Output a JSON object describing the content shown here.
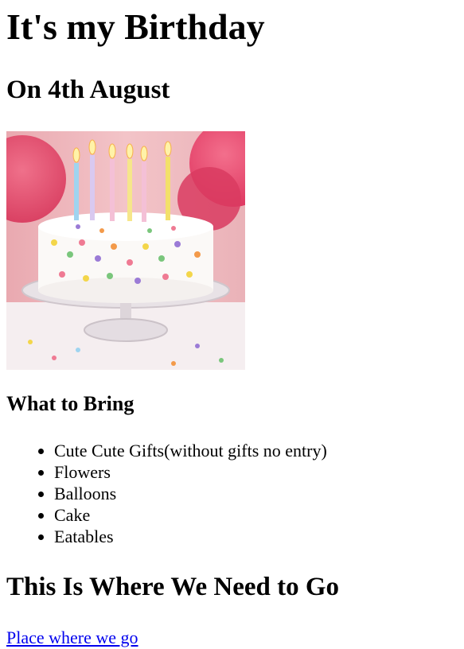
{
  "page": {
    "title": "It's my Birthday",
    "date": "On 4th August",
    "image_description": "birthday-cake-photo",
    "bring_heading": "What to Bring",
    "bring_items": [
      "Cute Cute Gifts(without gifts no entry)",
      "Flowers",
      "Balloons",
      "Cake",
      "Eatables"
    ],
    "go_heading": "This Is Where We Need to Go",
    "link_text": "Place where we go"
  },
  "colors": {
    "link": "#0000ee",
    "text": "#000000",
    "background": "#ffffff"
  }
}
